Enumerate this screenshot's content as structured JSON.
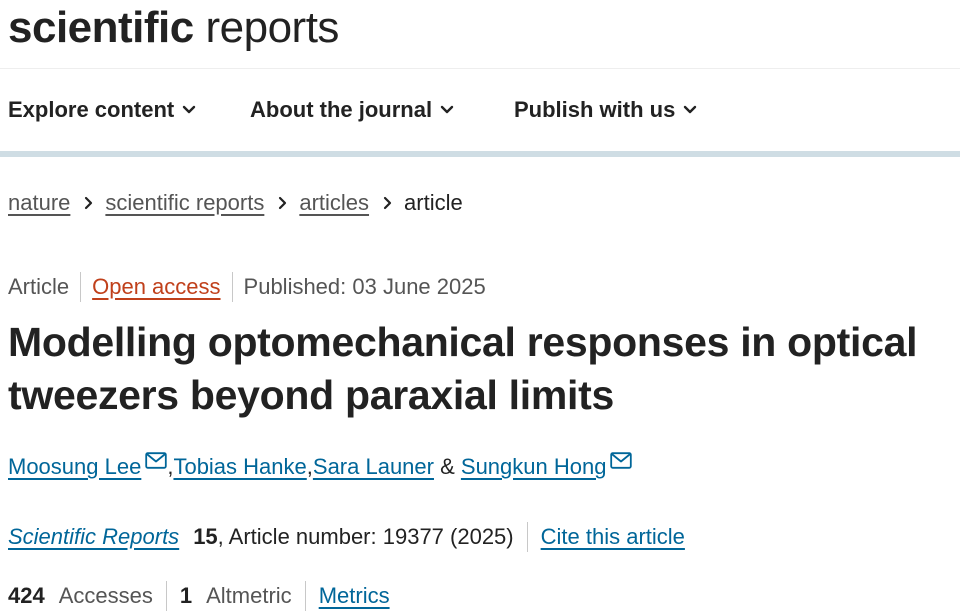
{
  "logo": {
    "bold": "scientific",
    "regular": "reports"
  },
  "nav": [
    {
      "label": "Explore content"
    },
    {
      "label": "About the journal"
    },
    {
      "label": "Publish with us"
    }
  ],
  "breadcrumb": {
    "items": [
      "nature",
      "scientific reports",
      "articles"
    ],
    "current": "article"
  },
  "meta": {
    "type": "Article",
    "access": "Open access",
    "published": "Published: 03 June 2025"
  },
  "title": "Modelling optomechanical responses in optical tweezers beyond paraxial limits",
  "authors": {
    "list": [
      "Moosung Lee",
      "Tobias Hanke",
      "Sara Launer",
      "Sungkun Hong"
    ],
    "sep1": ", ",
    "sep2": ", ",
    "and": " & "
  },
  "citation": {
    "journal": "Scientific Reports",
    "volume": "15",
    "article_number": ", Article number: 19377 (2025)",
    "cite": "Cite this article"
  },
  "metrics": {
    "accesses_count": "424",
    "accesses_label": "Accesses",
    "altmetric_count": "1",
    "altmetric_label": "Altmetric",
    "link": "Metrics"
  },
  "colors": {
    "link": "#006699",
    "open_access": "#c0401b",
    "nav_rule": "#cfdde4"
  },
  "icons": {
    "nav_chevron": "chevron-down-icon",
    "breadcrumb_separator": "chevron-right-icon",
    "author_contact": "mail-icon"
  }
}
